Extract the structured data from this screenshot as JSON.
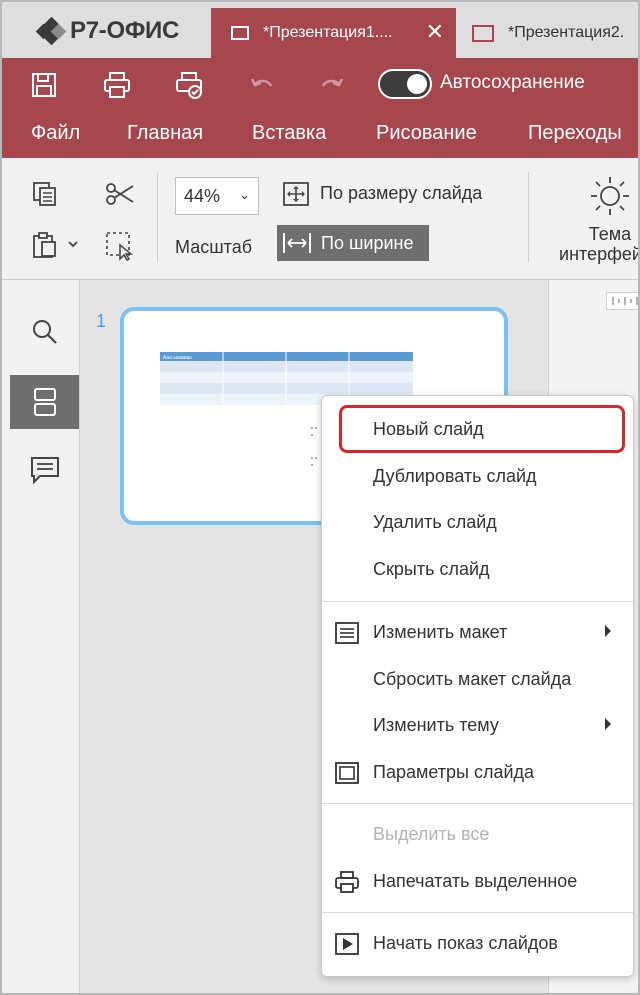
{
  "app": {
    "logo_text": "Р7-ОФИС"
  },
  "tabs": [
    {
      "label": "*Презентация1....",
      "active": true
    },
    {
      "label": "*Презентация2."
    }
  ],
  "quick_access": {
    "autosave_label": "Автосохранение",
    "autosave_on": true
  },
  "menu": [
    "Файл",
    "Главная",
    "Вставка",
    "Рисование",
    "Переходы"
  ],
  "toolbar": {
    "zoom_value": "44%",
    "scale_label": "Масштаб",
    "fit_slide_label": "По размеру слайда",
    "fit_width_label": "По ширине",
    "theme_label_line1": "Тема",
    "theme_label_line2": "интерфейса"
  },
  "slides": [
    {
      "number": "1",
      "table_header": "Ааа ыааааы"
    }
  ],
  "context_menu": {
    "items": [
      {
        "label": "Новый слайд",
        "highlighted": true
      },
      {
        "label": "Дублировать слайд"
      },
      {
        "label": "Удалить слайд"
      },
      {
        "label": "Скрыть слайд"
      },
      {
        "label": "Изменить макет",
        "icon": "layout-icon",
        "submenu": true
      },
      {
        "label": "Сбросить макет слайда"
      },
      {
        "label": "Изменить тему",
        "submenu": true
      },
      {
        "label": "Параметры слайда",
        "icon": "slide-settings-icon"
      },
      {
        "label": "Выделить все",
        "disabled": true
      },
      {
        "label": "Напечатать выделенное",
        "icon": "print-icon"
      },
      {
        "label": "Начать показ слайдов",
        "icon": "play-icon"
      }
    ]
  },
  "colors": {
    "brand": "#a5474c",
    "selection": "#7cc0f4",
    "highlight_ring": "#d9262b"
  }
}
